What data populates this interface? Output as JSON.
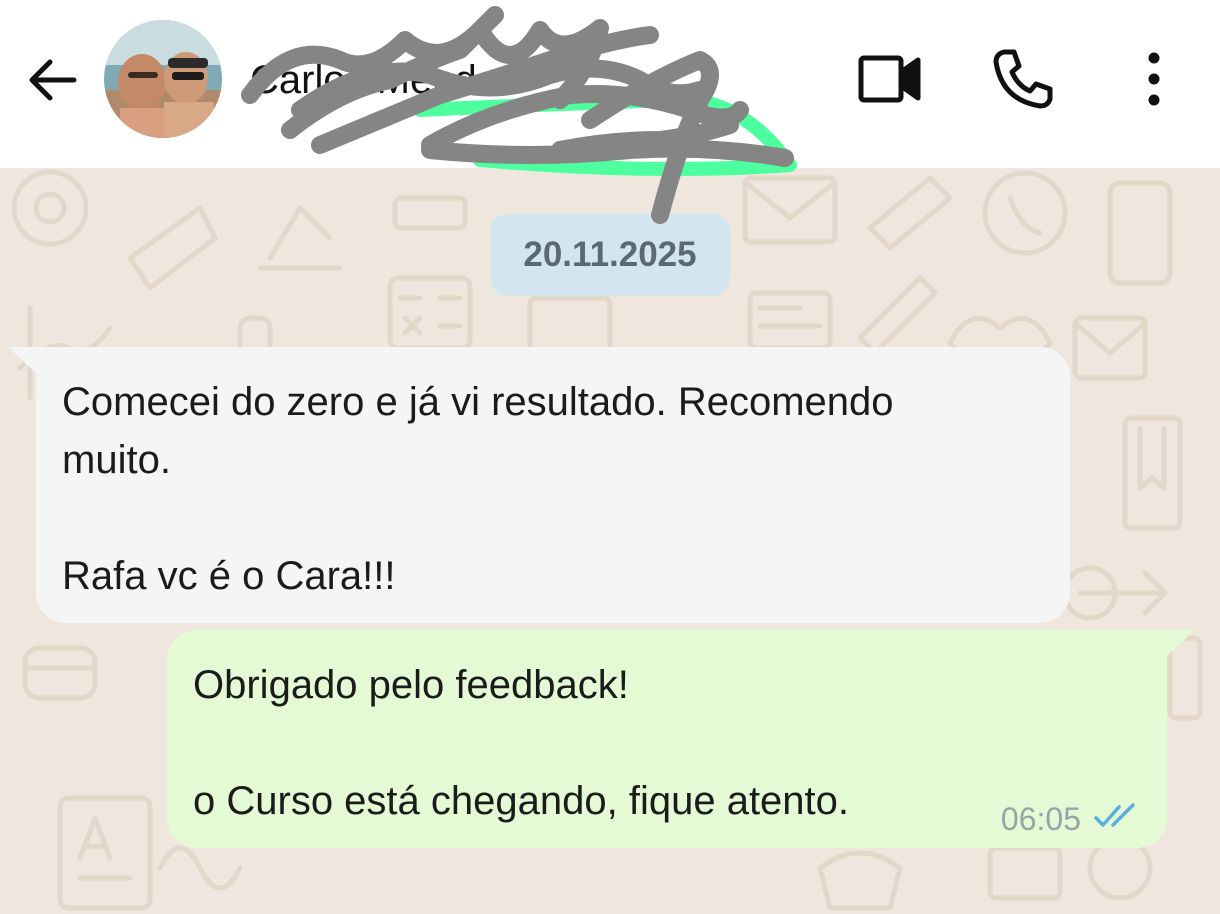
{
  "header": {
    "contact_name": "Carlos Mendes",
    "icons": {
      "back": "arrow-left-icon",
      "video": "video-camera-icon",
      "call": "phone-icon",
      "menu": "more-vertical-icon"
    }
  },
  "chat": {
    "date": "20.11.2025",
    "messages": [
      {
        "direction": "incoming",
        "lines": [
          "Comecei do zero e já vi resultado. Recomendo",
          "muito.",
          "",
          "Rafa vc é o Cara!!!"
        ]
      },
      {
        "direction": "outgoing",
        "lines": [
          "Obrigado pelo feedback!",
          "",
          "o Curso está chegando, fique atento."
        ],
        "time": "06:05",
        "status": "delivered"
      }
    ]
  },
  "colors": {
    "chat_background": "#efe7de",
    "incoming_bubble": "#f5f5f5",
    "outgoing_bubble": "#e3fad5",
    "date_chip": "#d3e6ef",
    "tick_color": "#5aaee0"
  }
}
